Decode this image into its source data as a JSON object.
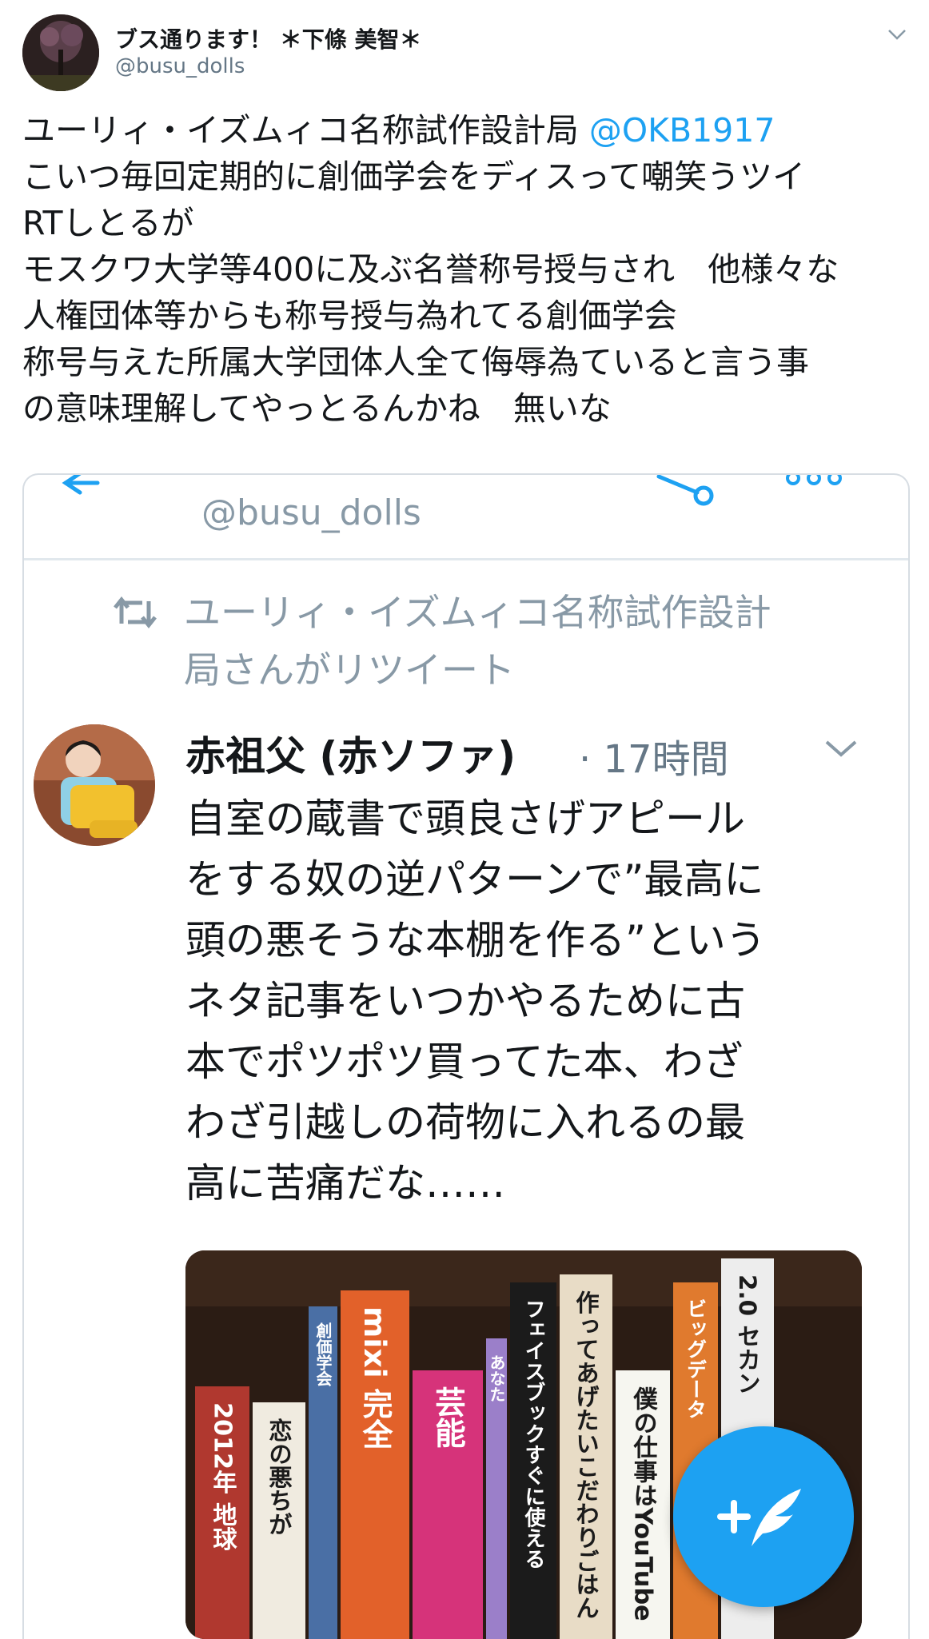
{
  "tweet": {
    "user_name": "ブス通ります！ ＊下條 美智＊",
    "handle": "@busu_dolls",
    "lines": [
      "ユーリィ・イズムィコ名称試作設計局 ",
      "こいつ毎回定期的に創価学会をディスって嘲笑うツイ",
      "RTしとるが",
      "モスクワ大学等400に及ぶ名誉称号授与され　他様々な",
      "人権団体等からも称号授与為れてる創価学会",
      "称号与えた所属大学団体人全て侮辱為ていると言う事",
      "の意味理解してやっとるんかね　無いな"
    ],
    "mention": "@OKB1917"
  },
  "card": {
    "handle": "@busu_dolls",
    "retweet_lines": [
      "ユーリィ・イズムィコ名称試作設計",
      "局さんがリツイート"
    ],
    "quoted": {
      "name": "赤祖父 (赤ソファ)",
      "time": "· 17時間",
      "lines": [
        "自室の蔵書で頭良さげアピール",
        "をする奴の逆パターンで”最高に",
        "頭の悪そうな本棚を作る”という",
        "ネタ記事をいつかやるために古",
        "本でポツポツ買ってた本、わざ",
        "わざ引越しの荷物に入れるの最",
        "高に苦痛だな……"
      ]
    }
  },
  "photo": {
    "spines": [
      {
        "text": "2012年 地球",
        "color": "#b0382f"
      },
      {
        "text": "恋の悪ちが",
        "color": "#f0ebe0"
      },
      {
        "text": "創価学会",
        "color": "#4a6fa5"
      },
      {
        "text": "mixi 完全",
        "color": "#e2612a"
      },
      {
        "text": "芸能",
        "color": "#d6337a"
      },
      {
        "text": "あなた",
        "color": "#9b7fc9"
      },
      {
        "text": "フェイスブックすぐに使える",
        "color": "#1b1b1b"
      },
      {
        "text": "作ってあげたいこだわりごはん",
        "color": "#e8dcc6"
      },
      {
        "text": "僕の仕事はYouTube",
        "color": "#f6f6f0"
      },
      {
        "text": "ビッグデータ",
        "color": "#e07a2e"
      },
      {
        "text": "2.0 セカン",
        "color": "#ededed"
      }
    ]
  },
  "colors": {
    "accent": "#1da1f2",
    "muted": "#8899a6",
    "text": "#14171a"
  },
  "icons": [
    "chevron-down-icon",
    "retweet-icon",
    "compose-tweet-icon",
    "back-arrow-icon",
    "share-icon",
    "more-icon"
  ]
}
